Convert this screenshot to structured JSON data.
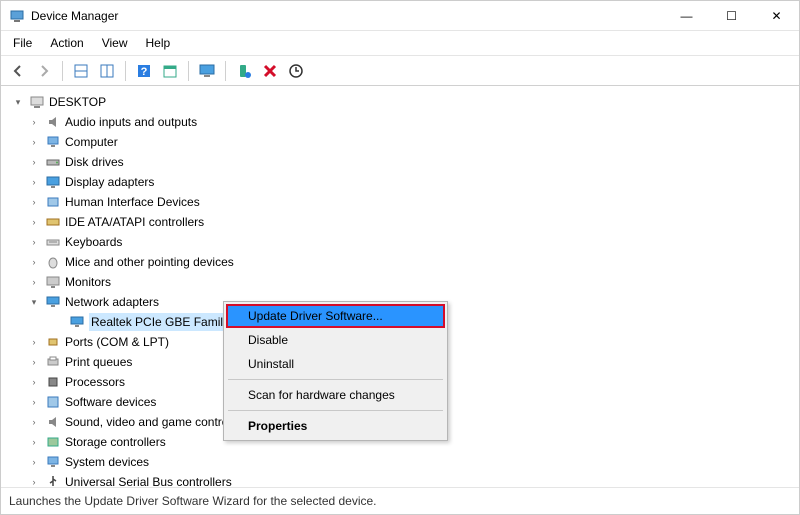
{
  "window": {
    "title": "Device Manager",
    "controls": {
      "minimize": "—",
      "maximize": "☐",
      "close": "✕"
    }
  },
  "menu": {
    "file": "File",
    "action": "Action",
    "view": "View",
    "help": "Help"
  },
  "toolbar": {
    "back": "back-arrow",
    "forward": "forward-arrow",
    "properties": "properties",
    "help": "help",
    "scan": "scan-hardware",
    "monitor": "monitor",
    "add": "add-hardware",
    "remove": "remove",
    "update": "update"
  },
  "tree": {
    "root": "DESKTOP",
    "nodes": [
      {
        "label": "Audio inputs and outputs",
        "icon": "audio"
      },
      {
        "label": "Computer",
        "icon": "computer"
      },
      {
        "label": "Disk drives",
        "icon": "disk"
      },
      {
        "label": "Display adapters",
        "icon": "display"
      },
      {
        "label": "Human Interface Devices",
        "icon": "hid"
      },
      {
        "label": "IDE ATA/ATAPI controllers",
        "icon": "ide"
      },
      {
        "label": "Keyboards",
        "icon": "keyboard"
      },
      {
        "label": "Mice and other pointing devices",
        "icon": "mouse"
      },
      {
        "label": "Monitors",
        "icon": "monitor"
      },
      {
        "label": "Network adapters",
        "icon": "network",
        "expanded": true,
        "children": [
          {
            "label": "Realtek PCIe GBE Family Controller",
            "icon": "nic",
            "selected": true
          }
        ]
      },
      {
        "label": "Ports (COM & LPT)",
        "icon": "port"
      },
      {
        "label": "Print queues",
        "icon": "printer"
      },
      {
        "label": "Processors",
        "icon": "cpu"
      },
      {
        "label": "Software devices",
        "icon": "software"
      },
      {
        "label": "Sound, video and game controllers",
        "icon": "sound"
      },
      {
        "label": "Storage controllers",
        "icon": "storage"
      },
      {
        "label": "System devices",
        "icon": "system"
      },
      {
        "label": "Universal Serial Bus controllers",
        "icon": "usb"
      }
    ]
  },
  "contextMenu": {
    "update": "Update Driver Software...",
    "disable": "Disable",
    "uninstall": "Uninstall",
    "scan": "Scan for hardware changes",
    "properties": "Properties"
  },
  "status": "Launches the Update Driver Software Wizard for the selected device."
}
